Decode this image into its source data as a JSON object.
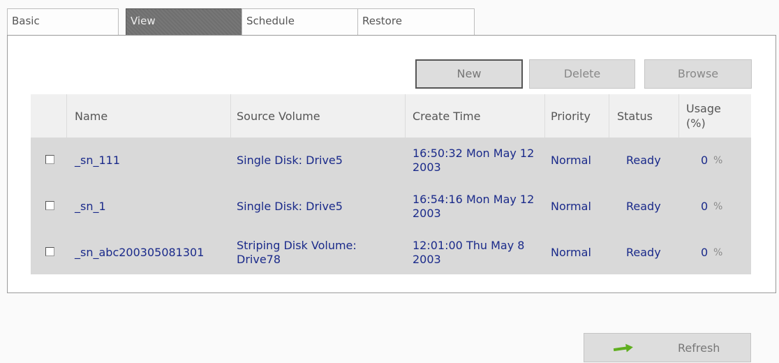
{
  "tabs": [
    {
      "label": "Basic"
    },
    {
      "label": "View",
      "active": true
    },
    {
      "label": "Schedule"
    },
    {
      "label": "Restore"
    }
  ],
  "buttons": {
    "new": "New",
    "delete": "Delete",
    "browse": "Browse",
    "refresh": "Refresh"
  },
  "table": {
    "headers": [
      "Name",
      "Source Volume",
      "Create Time",
      "Priority",
      "Status",
      "Usage (%)"
    ],
    "rows": [
      {
        "name": "_sn_111",
        "source": "Single Disk: Drive5",
        "time": "16:50:32 Mon May 12 2003",
        "priority": "Normal",
        "status": "Ready",
        "usage": "0",
        "unit": "%"
      },
      {
        "name": "_sn_1",
        "source": "Single Disk: Drive5",
        "time": "16:54:16 Mon May 12 2003",
        "priority": "Normal",
        "status": "Ready",
        "usage": "0",
        "unit": "%"
      },
      {
        "name": "_sn_abc200305081301",
        "source": "Striping Disk Volume: Drive78",
        "time": "12:01:00 Thu May 8 2003",
        "priority": "Normal",
        "status": "Ready",
        "usage": "0",
        "unit": "%"
      }
    ]
  },
  "colors": {
    "link_text": "#1a2a8a",
    "active_tab": "#6f6f6f",
    "row_background": "#d9d9d9",
    "refresh_icon": "#5fae1f"
  }
}
